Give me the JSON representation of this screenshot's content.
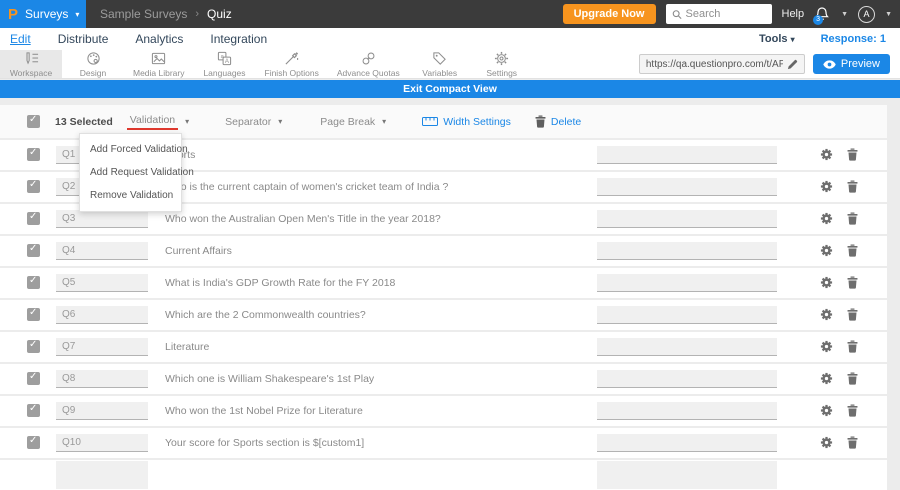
{
  "header": {
    "logo_letter": "P",
    "product": "Surveys",
    "breadcrumb_parent": "Sample Surveys",
    "breadcrumb_sep": "›",
    "breadcrumb_current": "Quiz",
    "upgrade_label": "Upgrade Now",
    "search_placeholder": "Search",
    "help_label": "Help",
    "notification_count": "3",
    "avatar_letter": "A"
  },
  "nav": {
    "tabs": [
      {
        "label": "Edit",
        "active": true
      },
      {
        "label": "Distribute",
        "active": false
      },
      {
        "label": "Analytics",
        "active": false
      },
      {
        "label": "Integration",
        "active": false
      }
    ],
    "tools_label": "Tools",
    "response_label": "Response: 1"
  },
  "toolbar": {
    "items": [
      {
        "label": "Workspace",
        "icon": "workspace-icon",
        "active": true
      },
      {
        "label": "Design",
        "icon": "design-icon",
        "active": false
      },
      {
        "label": "Media Library",
        "icon": "media-library-icon",
        "active": false
      },
      {
        "label": "Languages",
        "icon": "languages-icon",
        "active": false
      },
      {
        "label": "Finish Options",
        "icon": "finish-options-icon",
        "active": false
      },
      {
        "label": "Advance Quotas",
        "icon": "advance-quotas-icon",
        "active": false
      },
      {
        "label": "Variables",
        "icon": "variables-icon",
        "active": false
      },
      {
        "label": "Settings",
        "icon": "settings-icon",
        "active": false
      }
    ],
    "url_value": "https://qa.questionpro.com/t/APNrFZeY",
    "preview_label": "Preview"
  },
  "compact_bar": {
    "label": "Exit Compact View"
  },
  "bulk_bar": {
    "selected_label": "13 Selected",
    "dropdowns": [
      {
        "label": "Validation",
        "underline": true
      },
      {
        "label": "Separator",
        "underline": false
      },
      {
        "label": "Page Break",
        "underline": false
      }
    ],
    "width_settings_label": "Width Settings",
    "delete_label": "Delete"
  },
  "validation_menu": {
    "items": [
      "Add Forced Validation",
      "Add Request Validation",
      "Remove Validation"
    ]
  },
  "questions": [
    {
      "code": "Q1",
      "text": "Sports",
      "value": ""
    },
    {
      "code": "Q2",
      "text": "Who is the current captain of women's cricket team of India ?",
      "value": ""
    },
    {
      "code": "Q3",
      "text": "Who won the Australian Open Men's Title in the year 2018?",
      "value": ""
    },
    {
      "code": "Q4",
      "text": "Current Affairs",
      "value": ""
    },
    {
      "code": "Q5",
      "text": "What is India's GDP Growth Rate for the FY 2018",
      "value": ""
    },
    {
      "code": "Q6",
      "text": "Which are the 2 Commonwealth countries?",
      "value": ""
    },
    {
      "code": "Q7",
      "text": "Literature",
      "value": ""
    },
    {
      "code": "Q8",
      "text": "Which one is William Shakespeare's 1st Play",
      "value": ""
    },
    {
      "code": "Q9",
      "text": "Who won the 1st Nobel Prize for Literature",
      "value": ""
    },
    {
      "code": "Q10",
      "text": "Your score for Sports section is $[custom1]",
      "value": ""
    }
  ],
  "colors": {
    "accent_blue": "#1b87e6",
    "accent_orange": "#f7941e",
    "topbar_dark": "#3b3b3b",
    "underline_red": "#df392e"
  }
}
